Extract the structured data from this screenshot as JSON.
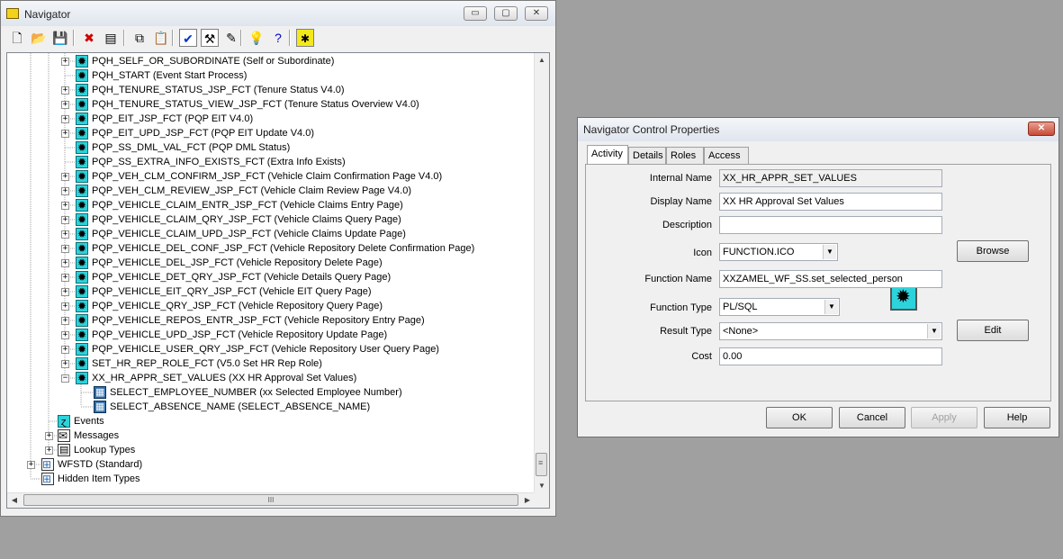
{
  "navigator": {
    "title": "Navigator",
    "caption_buttons": {
      "minimize": "▭",
      "maximize": "▢",
      "close": "✕"
    },
    "toolbar": [
      {
        "name": "new-icon",
        "glyph": "🗋"
      },
      {
        "name": "open-icon",
        "glyph": "📂"
      },
      {
        "name": "save-icon",
        "glyph": "💾"
      },
      {
        "name": "delete-icon",
        "glyph": "✖"
      },
      {
        "name": "print-icon",
        "glyph": "▤"
      },
      {
        "name": "copy-icon",
        "glyph": "⧉"
      },
      {
        "name": "paste-icon",
        "glyph": "📋"
      },
      {
        "name": "verify-icon",
        "glyph": "✔"
      },
      {
        "name": "hammer-icon",
        "glyph": "⚒"
      },
      {
        "name": "wand-icon",
        "glyph": "✎"
      },
      {
        "name": "bulb-icon",
        "glyph": "💡"
      },
      {
        "name": "help-icon",
        "glyph": "?"
      },
      {
        "name": "star-icon",
        "glyph": "✱"
      }
    ],
    "tree": [
      {
        "label": "PQH_SELF_OR_SUBORDINATE (Self or Subordinate)",
        "icon": "fn",
        "exp": "+"
      },
      {
        "label": "PQH_START (Event Start Process)",
        "icon": "fn",
        "exp": ""
      },
      {
        "label": "PQH_TENURE_STATUS_JSP_FCT (Tenure  Status V4.0)",
        "icon": "fn",
        "exp": "+"
      },
      {
        "label": "PQH_TENURE_STATUS_VIEW_JSP_FCT (Tenure Status Overview V4.0)",
        "icon": "fn",
        "exp": "+"
      },
      {
        "label": "PQP_EIT_JSP_FCT (PQP EIT V4.0)",
        "icon": "fn",
        "exp": "+"
      },
      {
        "label": "PQP_EIT_UPD_JSP_FCT (PQP EIT Update V4.0)",
        "icon": "fn",
        "exp": "+"
      },
      {
        "label": "PQP_SS_DML_VAL_FCT (PQP DML Status)",
        "icon": "fn",
        "exp": ""
      },
      {
        "label": "PQP_SS_EXTRA_INFO_EXISTS_FCT (Extra Info Exists)",
        "icon": "fn",
        "exp": ""
      },
      {
        "label": "PQP_VEH_CLM_CONFIRM_JSP_FCT (Vehicle Claim Confirmation Page V4.0)",
        "icon": "fn",
        "exp": "+"
      },
      {
        "label": "PQP_VEH_CLM_REVIEW_JSP_FCT (Vehicle Claim Review Page V4.0)",
        "icon": "fn",
        "exp": "+"
      },
      {
        "label": "PQP_VEHICLE_CLAIM_ENTR_JSP_FCT (Vehicle Claims Entry Page)",
        "icon": "fn",
        "exp": "+"
      },
      {
        "label": "PQP_VEHICLE_CLAIM_QRY_JSP_FCT (Vehicle Claims Query Page)",
        "icon": "fn",
        "exp": "+"
      },
      {
        "label": "PQP_VEHICLE_CLAIM_UPD_JSP_FCT (Vehicle Claims Update Page)",
        "icon": "fn",
        "exp": "+"
      },
      {
        "label": "PQP_VEHICLE_DEL_CONF_JSP_FCT (Vehicle Repository Delete Confirmation Page)",
        "icon": "fn",
        "exp": "+"
      },
      {
        "label": "PQP_VEHICLE_DEL_JSP_FCT (Vehicle Repository Delete Page)",
        "icon": "fn",
        "exp": "+"
      },
      {
        "label": "PQP_VEHICLE_DET_QRY_JSP_FCT (Vehicle Details Query Page)",
        "icon": "fn",
        "exp": "+"
      },
      {
        "label": "PQP_VEHICLE_EIT_QRY_JSP_FCT (Vehicle EIT Query Page)",
        "icon": "fn",
        "exp": "+"
      },
      {
        "label": "PQP_VEHICLE_QRY_JSP_FCT (Vehicle Repository Query Page)",
        "icon": "fn",
        "exp": "+"
      },
      {
        "label": "PQP_VEHICLE_REPOS_ENTR_JSP_FCT (Vehicle Repository Entry Page)",
        "icon": "fn",
        "exp": "+"
      },
      {
        "label": "PQP_VEHICLE_UPD_JSP_FCT (Vehicle Repository Update Page)",
        "icon": "fn",
        "exp": "+"
      },
      {
        "label": "PQP_VEHICLE_USER_QRY_JSP_FCT (Vehicle Repository User Query Page)",
        "icon": "fn",
        "exp": "+"
      },
      {
        "label": "SET_HR_REP_ROLE_FCT (V5.0 Set HR Rep Role)",
        "icon": "fn",
        "exp": "+"
      },
      {
        "label": "XX_HR_APPR_SET_VALUES (XX HR Approval Set Values)",
        "icon": "fn",
        "exp": "−"
      },
      {
        "label": "SELECT_EMPLOYEE_NUMBER (xx Selected Employee Number)",
        "icon": "attr",
        "exp": "",
        "level": 2
      },
      {
        "label": "SELECT_ABSENCE_NAME (SELECT_ABSENCE_NAME)",
        "icon": "attr",
        "exp": "",
        "level": 2
      },
      {
        "label": "Events",
        "icon": "evt",
        "exp": "",
        "level": 0
      },
      {
        "label": "Messages",
        "icon": "msg",
        "exp": "+",
        "level": 0
      },
      {
        "label": "Lookup Types",
        "icon": "lookup",
        "exp": "+",
        "level": 0
      },
      {
        "label": "WFSTD (Standard)",
        "icon": "wf",
        "exp": "+",
        "level": -1
      },
      {
        "label": "Hidden Item Types",
        "icon": "wf",
        "exp": "",
        "level": -1
      }
    ],
    "scroll_grip": "≡",
    "hscroll_grip": "III"
  },
  "dialog": {
    "title": "Navigator Control Properties",
    "close": "✕",
    "tabs": [
      "Activity",
      "Details",
      "Roles",
      "Access"
    ],
    "active_tab": "Activity",
    "fields": {
      "internal_name": {
        "label": "Internal Name",
        "value": "XX_HR_APPR_SET_VALUES"
      },
      "display_name": {
        "label": "Display Name",
        "value": "XX HR Approval Set Values"
      },
      "description": {
        "label": "Description",
        "value": ""
      },
      "icon": {
        "label": "Icon",
        "value": "FUNCTION.ICO"
      },
      "function_name": {
        "label": "Function Name",
        "value": "XXZAMEL_WF_SS.set_selected_person"
      },
      "function_type": {
        "label": "Function Type",
        "value": "PL/SQL"
      },
      "result_type": {
        "label": "Result Type",
        "value": "<None>"
      },
      "cost": {
        "label": "Cost",
        "value": "0.00"
      }
    },
    "buttons": {
      "browse": "Browse",
      "edit": "Edit",
      "ok": "OK",
      "cancel": "Cancel",
      "apply": "Apply",
      "help": "Help"
    }
  }
}
